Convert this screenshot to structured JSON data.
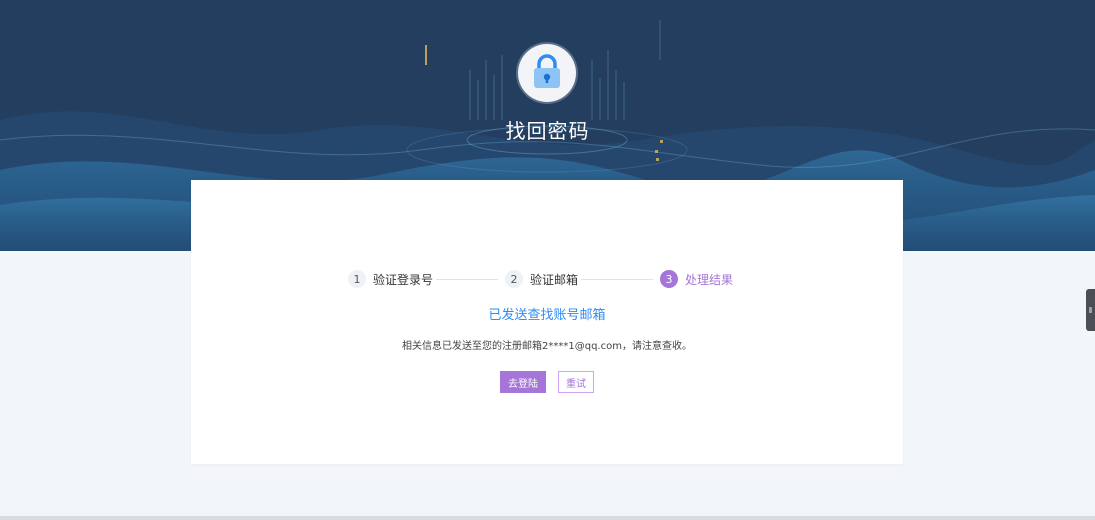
{
  "header": {
    "title": "找回密码"
  },
  "steps": [
    {
      "number": "1",
      "label": "验证登录号",
      "state": "done"
    },
    {
      "number": "2",
      "label": "验证邮箱",
      "state": "done"
    },
    {
      "number": "3",
      "label": "处理结果",
      "state": "active"
    }
  ],
  "result": {
    "title": "已发送查找账号邮箱",
    "description": "相关信息已发送至您的注册邮箱2****1@qq.com，请注意查收。"
  },
  "buttons": {
    "login_label": "去登陆",
    "retry_label": "重试"
  },
  "colors": {
    "hero_bg": "#233e5f",
    "accent": "#a575d9",
    "result_title": "#2f8cf0",
    "page_bg": "#f3f6f9"
  },
  "icons": {
    "hero": "lock-icon"
  }
}
